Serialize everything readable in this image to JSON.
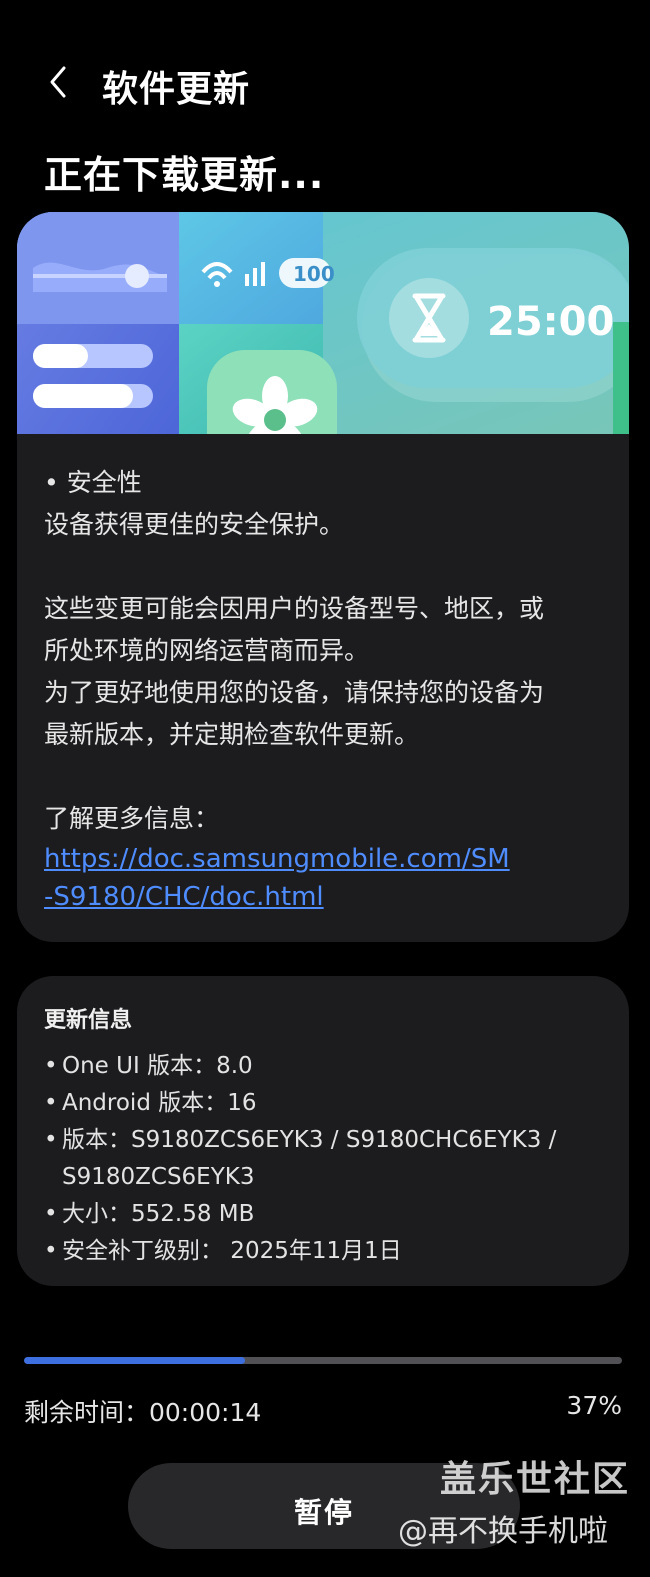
{
  "header": {
    "title": "软件更新"
  },
  "page_title": "正在下载更新...",
  "banner": {
    "timer": "25:00",
    "battery": "100"
  },
  "notes": {
    "security_heading": "• 安全性",
    "security_desc": "设备获得更佳的安全保护。",
    "variance_1": "这些变更可能会因用户的设备型号、地区，或",
    "variance_2": "所处环境的网络运营商而异。",
    "advice_1": "为了更好地使用您的设备，请保持您的设备为",
    "advice_2": "最新版本，并定期检查软件更新。",
    "more_info_label": "了解更多信息：",
    "link_line_1": "https://doc.samsungmobile.com/SM",
    "link_line_2": "-S9180/CHC/doc.html"
  },
  "update_info": {
    "title": "更新信息",
    "items": [
      "One UI 版本：8.0",
      "Android 版本：16",
      "版本：S9180ZCS6EYK3 / S9180CHC6EYK3 / S9180ZCS6EYK3",
      "大小：552.58 MB",
      "安全补丁级别： 2025年11月1日"
    ]
  },
  "download": {
    "progress_fraction": 0.37,
    "remaining_label": "剩余时间：00:00:14",
    "percent_label": "37%"
  },
  "pause_button": {
    "label": "暂停"
  },
  "watermark": {
    "site": "盖乐世社区",
    "user": "@再不换手机啦"
  },
  "colors": {
    "accent": "#3d6fe0",
    "link": "#4f8dff",
    "card": "#1c1c1f",
    "background": "#000000"
  }
}
